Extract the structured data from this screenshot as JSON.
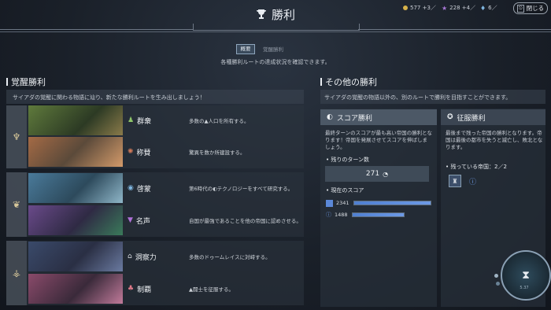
{
  "header": {
    "title": "勝利",
    "close_label": "閉じる",
    "resources": [
      {
        "icon": "gold-coin-icon",
        "value": "577 +3／",
        "color": "#d7b24a"
      },
      {
        "icon": "influence-star-icon",
        "value": "228 +4／",
        "color": "#a778d6"
      },
      {
        "icon": "science-flask-icon",
        "value": "6／",
        "color": "#7fb6e0"
      }
    ]
  },
  "tabs": [
    {
      "label": "概要",
      "active": true
    },
    {
      "label": "覚醒勝利",
      "active": false
    }
  ],
  "subtitle": "各種勝利ルートの達成状況を確認できます。",
  "awakening": {
    "title": "覚醒勝利",
    "desc": "サイアダの覚醒に関わる物語に辿り、新たな勝利ルートを生み出しましょう！",
    "rows": [
      {
        "name": "群衆",
        "desc": "多数の▲人口を所有する。",
        "icon": "population-icon",
        "color": "#8fc66a"
      },
      {
        "name": "称賛",
        "desc": "驚異を数か所建設する。",
        "icon": "wonder-icon",
        "color": "#d07a5a"
      },
      {
        "name": "啓蒙",
        "desc": "第6時代の◐テクノロジーをすべて研究する。",
        "icon": "technology-icon",
        "color": "#7fb6e0"
      },
      {
        "name": "名声",
        "desc": "自国が最強であることを他の帝国に認めさせる。",
        "icon": "fame-icon",
        "color": "#b070d8"
      },
      {
        "name": "洞察力",
        "desc": "多数のドゥームレイスに対峙する。",
        "icon": "insight-icon",
        "color": "#d9dde3"
      },
      {
        "name": "制覇",
        "desc": "▲闘士を征服する。",
        "icon": "domination-icon",
        "color": "#e07a8a"
      }
    ]
  },
  "other": {
    "title": "その他の勝利",
    "desc": "サイアダの覚醒の物語以外の、別のルートで勝利を目指すことができます。",
    "score": {
      "title": "スコア勝利",
      "desc": "最終ターンのスコアが最も高い帝国の勝利となります！帝国を発展させてスコアを伸ばしましょう。",
      "turns_label": "残りのターン数",
      "turns_value": "271",
      "current_label": "現在のスコア",
      "scores": [
        {
          "value": "2341",
          "fraction": 1.0,
          "color": "#5b88d8"
        },
        {
          "value": "1488",
          "fraction": 0.64,
          "color": "#5b88d8"
        }
      ]
    },
    "conquest": {
      "title": "征服勝利",
      "desc": "最後まで残った帝国の勝利となります。帝国は最後の都市を失うと滅亡し、敗北となります。",
      "remaining_label": "残っている帝国：2／2"
    }
  },
  "minimap": {
    "label": "5.37"
  }
}
